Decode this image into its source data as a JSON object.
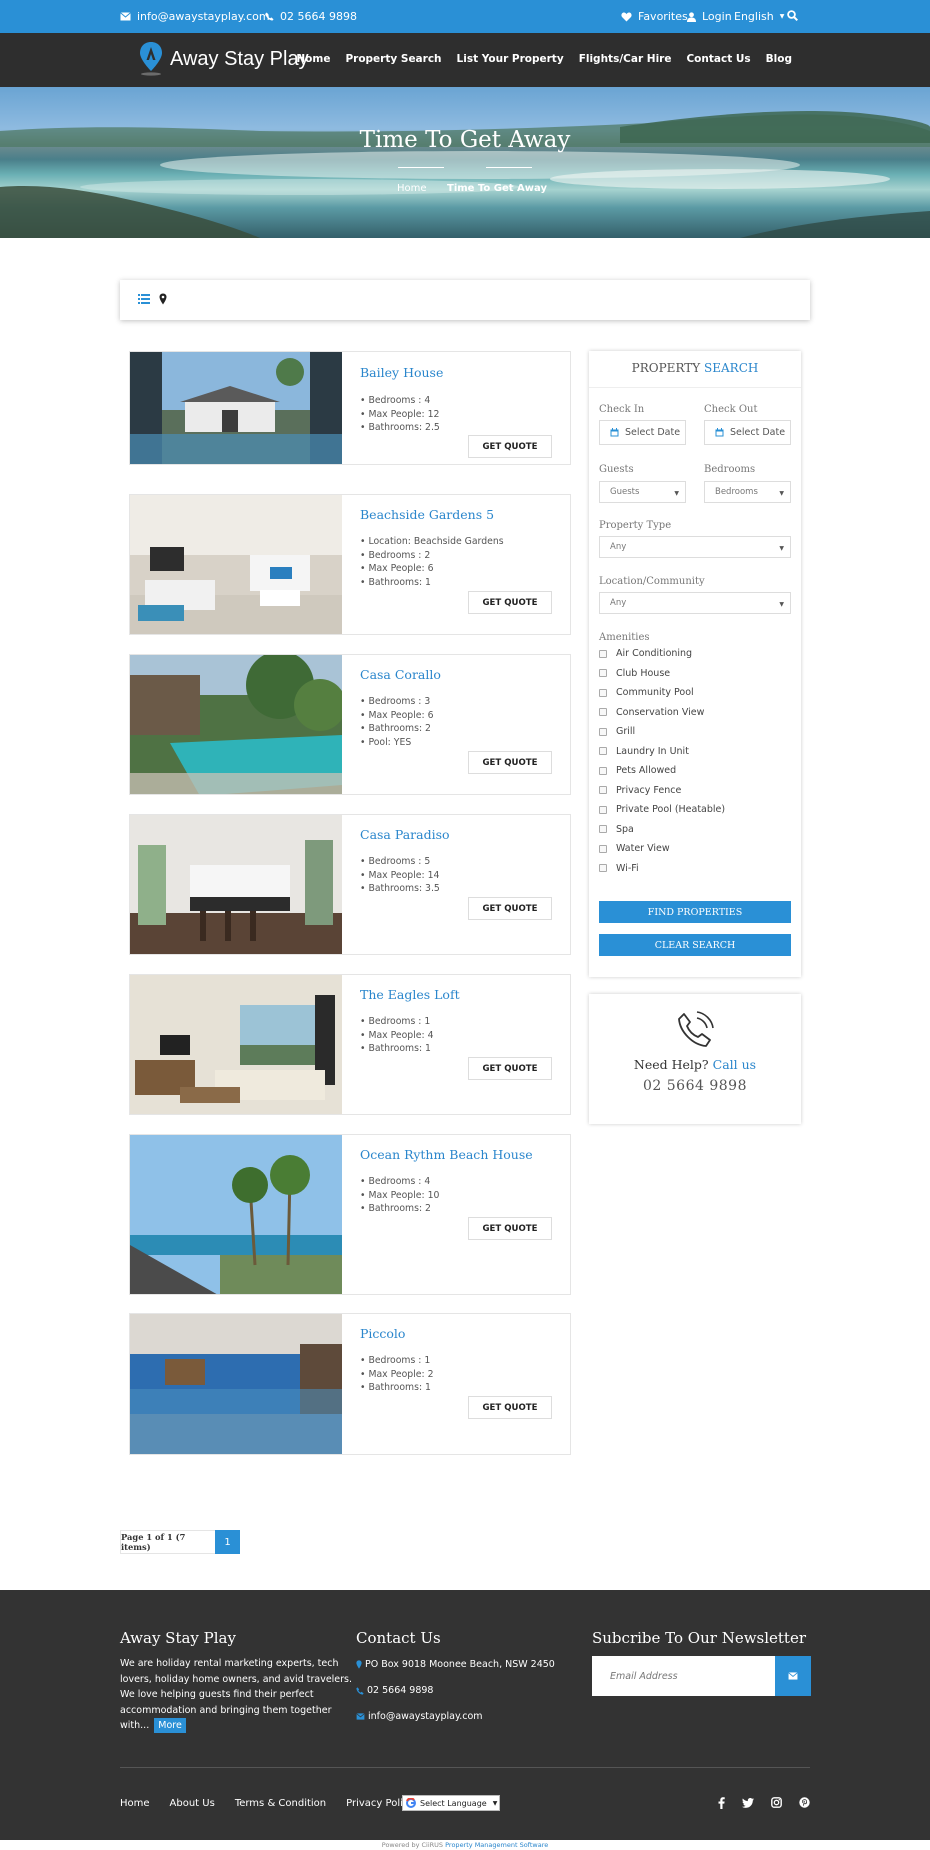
{
  "topbar": {
    "email": "info@awaystayplay.com",
    "phone": "02 5664 9898",
    "favorites": "Favorites",
    "login": "Login",
    "language": "English"
  },
  "brand": {
    "name": "Away Stay Play"
  },
  "nav": [
    "Home",
    "Property Search",
    "List Your Property",
    "Flights/Car Hire",
    "Contact Us",
    "Blog"
  ],
  "hero": {
    "title": "Time To Get Away",
    "breadcrumb": [
      "Home",
      "Time To Get Away"
    ]
  },
  "listings": [
    {
      "name": "Bailey House",
      "features": [
        "• Bedrooms : 4",
        "• Max People: 12",
        "• Bathrooms: 2.5"
      ],
      "cta": "GET QUOTE"
    },
    {
      "name": "Beachside Gardens 5",
      "features": [
        "• Location: Beachside Gardens",
        "• Bedrooms : 2",
        "• Max People: 6",
        "• Bathrooms: 1"
      ],
      "cta": "GET QUOTE"
    },
    {
      "name": "Casa Corallo",
      "features": [
        "• Bedrooms : 3",
        "• Max People: 6",
        "• Bathrooms: 2",
        "• Pool: YES"
      ],
      "cta": "GET QUOTE"
    },
    {
      "name": "Casa Paradiso",
      "features": [
        "• Bedrooms : 5",
        "• Max People: 14",
        "• Bathrooms: 3.5"
      ],
      "cta": "GET QUOTE"
    },
    {
      "name": "The Eagles Loft",
      "features": [
        "• Bedrooms : 1",
        "• Max People: 4",
        "• Bathrooms: 1"
      ],
      "cta": "GET QUOTE"
    },
    {
      "name": "Ocean Rythm Beach House",
      "features": [
        "• Bedrooms : 4",
        "• Max People: 10",
        "• Bathrooms: 2"
      ],
      "cta": "GET QUOTE"
    },
    {
      "name": "Piccolo",
      "features": [
        "• Bedrooms : 1",
        "• Max People: 2",
        "• Bathrooms: 1"
      ],
      "cta": "GET QUOTE"
    }
  ],
  "search": {
    "title_a": "PROPERTY",
    "title_b": "SEARCH",
    "checkin_label": "Check In",
    "checkout_label": "Check Out",
    "checkin_value": "Select Date",
    "checkout_value": "Select Date",
    "guests_label": "Guests",
    "bedrooms_label": "Bedrooms",
    "guests_value": "Guests",
    "bedrooms_value": "Bedrooms",
    "type_label": "Property Type",
    "type_value": "Any",
    "location_label": "Location/Community",
    "location_value": "Any",
    "amenities_label": "Amenities",
    "amenities": [
      "Air Conditioning",
      "Club House",
      "Community Pool",
      "Conservation View",
      "Grill",
      "Laundry In Unit",
      "Pets Allowed",
      "Privacy Fence",
      "Private Pool (Heatable)",
      "Spa",
      "Water View",
      "Wi-Fi"
    ],
    "find_button": "FIND PROPERTIES",
    "clear_button": "CLEAR SEARCH"
  },
  "help": {
    "text": "Need Help?",
    "link": "Call us",
    "phone": "02 5664 9898"
  },
  "pagination": {
    "info": "Page 1 of 1 (7 items)",
    "current": "1"
  },
  "footer": {
    "about_title": "Away Stay Play",
    "about_lines": [
      "We are holiday rental marketing experts, tech",
      "lovers, holiday home owners, and avid travelers.",
      "We love helping guests find their perfect",
      "accommodation and bringing them together",
      "with..."
    ],
    "more": "More",
    "contact_title": "Contact Us",
    "address": "PO Box 9018 Moonee Beach, NSW 2450",
    "phone": "02 5664 9898",
    "email": "info@awaystayplay.com",
    "newsletter_title": "Subcribe To Our Newsletter",
    "newsletter_placeholder": "Email Address",
    "links": [
      "Home",
      "About Us",
      "Terms & Condition",
      "Privacy Policy"
    ],
    "language_select": "Select Language",
    "powered_prefix": "Powered by CiiRUS",
    "powered_link": "Property Management Software"
  },
  "colors": {
    "accent": "#2a90d6",
    "nav_bg": "#2e2e2e",
    "footer_bg": "#333333",
    "link": "#2a86cc"
  },
  "icons": [
    "envelope-icon",
    "phone-icon",
    "heart-icon",
    "user-icon",
    "search-icon",
    "list-view-icon",
    "map-pin-icon",
    "calendar-icon",
    "phone-ring-icon",
    "send-icon",
    "facebook-icon",
    "twitter-icon",
    "instagram-icon",
    "pinterest-icon",
    "google-icon"
  ]
}
